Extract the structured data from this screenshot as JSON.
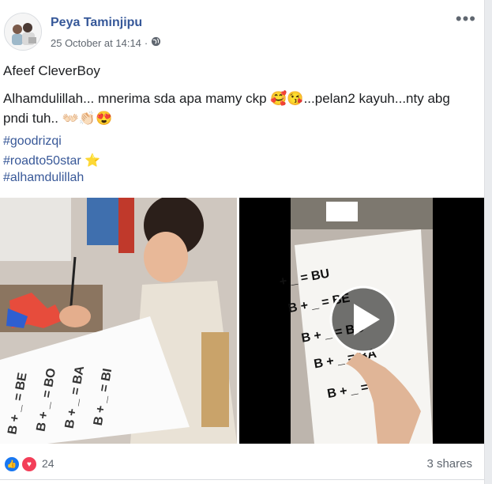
{
  "post": {
    "author": "Peya Taminjipu",
    "timestamp": "25 October at 14:14",
    "privacy_icon": "globe-icon",
    "more_icon": "more-options-icon",
    "title": "Afeef CleverBoy",
    "body": "Alhamdulillah... mnerima sda apa mamy ckp 🥰😘...pelan2 kayuh...nty abg pndi tuh.. 👐🏻👏🏻😍",
    "hashtags": [
      "#goodrizqi",
      "#roadto50star ⭐",
      "#alhamdulillah"
    ]
  },
  "media": {
    "worksheet_lines": [
      "B + _ = BE",
      "B + _ = BO",
      "B + _ = BA",
      "B + _ = BI"
    ],
    "video_lines": [
      "+ _ = BU",
      "B + _ = BE",
      "B + _ = BO",
      "B + _ = BA",
      "B + _ = BI"
    ],
    "play_icon": "play-icon"
  },
  "footer": {
    "reaction_count": "24",
    "shares": "3 shares",
    "colors": {
      "like": "#1877f2",
      "love": "#f33e58"
    }
  }
}
